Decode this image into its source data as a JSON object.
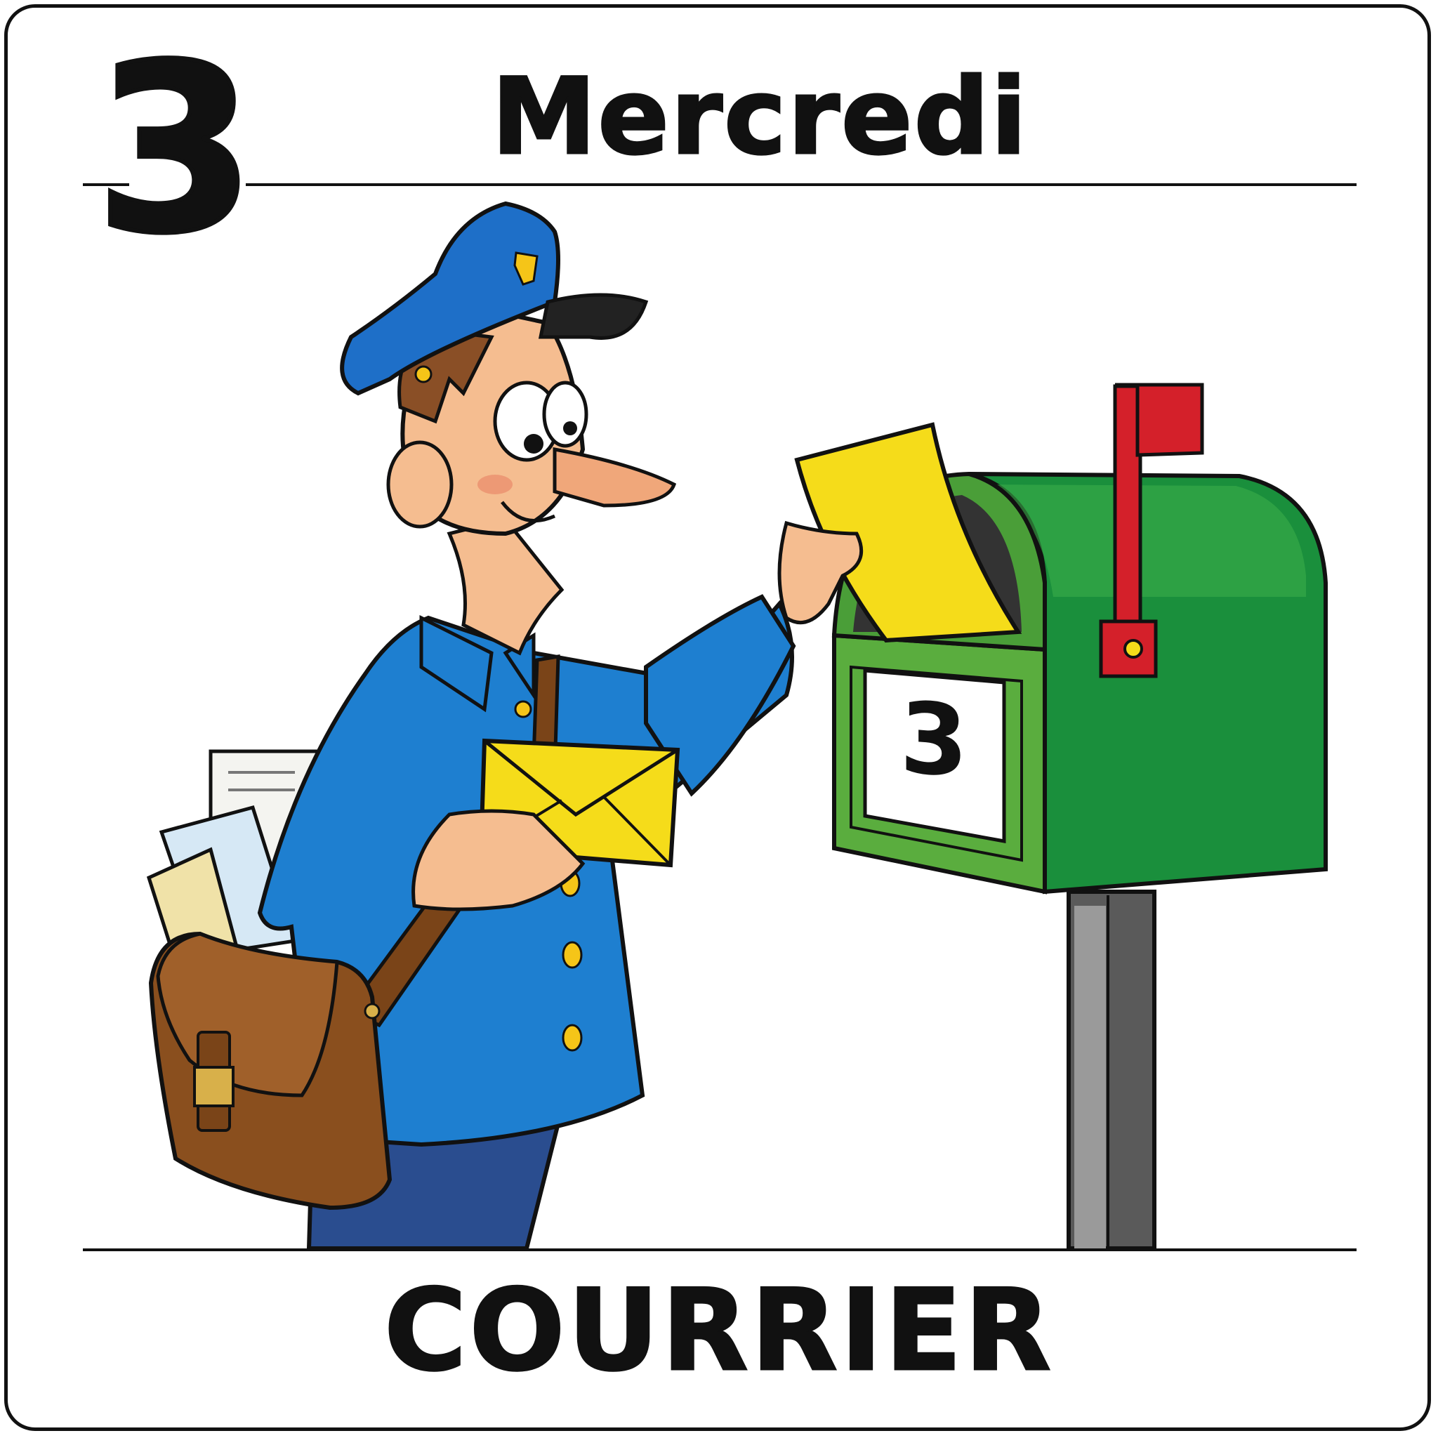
{
  "card": {
    "day_number": "3",
    "day_name": "Mercredi",
    "caption": "COURRIER"
  },
  "mailbox": {
    "house_number": "3",
    "colors": {
      "body": "#1f9a3a",
      "flag": "#d4202a",
      "post": "#555555"
    }
  },
  "mail_carrier": {
    "colors": {
      "uniform": "#1e7fd0",
      "cap": "#1e6fc8",
      "bag": "#8a4f1e",
      "envelope": "#f5dc1a",
      "trousers": "#2a4d8f"
    }
  }
}
